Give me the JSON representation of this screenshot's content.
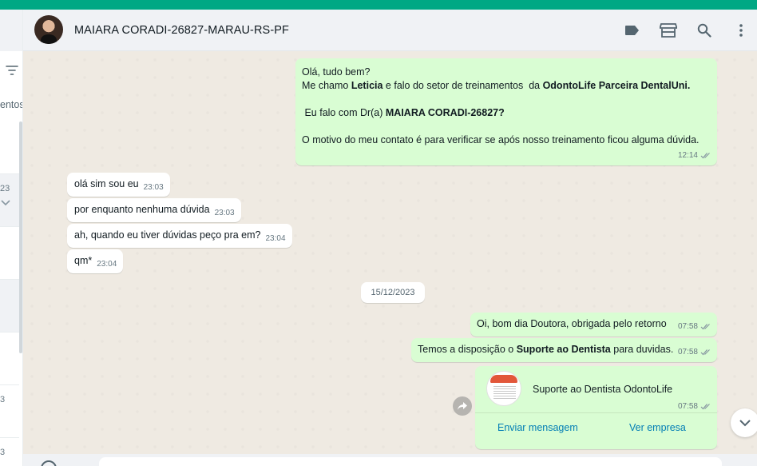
{
  "contact": {
    "name": "MAIARA CORADI-26827-MARAU-RS-PF"
  },
  "sidebar": {
    "tab_partial": "entos",
    "times": [
      "23",
      "3",
      "3"
    ]
  },
  "messages": {
    "first": {
      "greeting": "Olá, tudo bem?",
      "intro_prefix": "Me chamo ",
      "agent_name": "Leticia",
      "intro_middle": " e falo do setor de treinamentos  da ",
      "company": "OdontoLife Parceira DentalUni.",
      "check_prefix": " Eu falo com Dr(a) ",
      "check_name": "MAIARA CORADI-26827?",
      "reason": "O motivo do meu contato é para verificar se após nosso treinamento ficou alguma dúvida.",
      "time": "12:14"
    },
    "incoming": [
      {
        "text": "olá sim sou eu",
        "time": "23:03"
      },
      {
        "text": "por enquanto nenhuma dúvida",
        "time": "23:03"
      },
      {
        "text": "ah, quando eu tiver dúvidas peço pra em?",
        "time": "23:04"
      },
      {
        "text": "qm*",
        "time": "23:04"
      }
    ],
    "date_divider": "15/12/2023",
    "reply1": {
      "text": "Oi, bom dia Doutora, obrigada pelo retorno",
      "time": "07:58"
    },
    "reply2": {
      "prefix": "Temos a disposição o ",
      "bold": "Suporte ao Dentista",
      "suffix": " para duvidas.",
      "time": "07:58"
    },
    "card": {
      "title": "Suporte ao Dentista OdontoLife",
      "time": "07:58",
      "send_button": "Enviar mensagem",
      "view_button": "Ver empresa"
    }
  },
  "icons": [
    "label-icon",
    "store-icon",
    "search-icon",
    "menu-icon",
    "filter-icon",
    "forward-icon",
    "chevron-down-icon",
    "double-check-icon",
    "emoji-icon"
  ],
  "colors": {
    "accent": "#00a884",
    "outgoing": "#d9fdd3",
    "incoming": "#ffffff",
    "chat_bg": "#efeae2",
    "link": "#027eb5"
  }
}
